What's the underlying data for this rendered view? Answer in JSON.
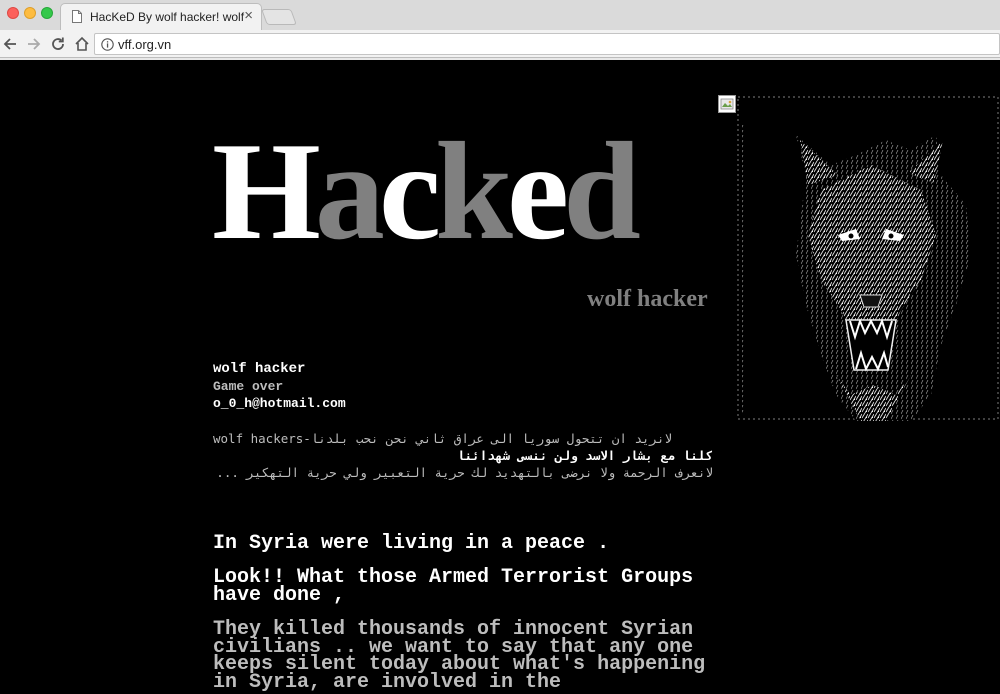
{
  "browser": {
    "tab_title": "HacKeD By wolf hacker! wolf",
    "tab_close": "×",
    "url": "vff.org.vn"
  },
  "page": {
    "headline": {
      "part1": "H",
      "part2": "a",
      "part3": "c",
      "part4": "k",
      "part5": "e",
      "part6": "d"
    },
    "signature": "wolf hacker",
    "info": {
      "name": "wolf hacker",
      "status": "Game over",
      "email": "o_0_h@hotmail.com"
    },
    "arabic": {
      "line1": "wolf hackers-لانريد ان تتحول سوريا الى عراق ثاني نحن نحب بلدنا",
      "line2": "كلنا مع بشار الاسد ولن ننسى شهدائنا",
      "line3": "لانعرف الرحمة ولا نرضى بالتهديد لك حرية التعبير ولي حرية التهكير ..."
    },
    "messages": {
      "m1": "In Syria were living in a peace .",
      "m2": "Look!! What those Armed Terrorist Groups have done ,",
      "m3": "They killed thousands of innocent Syrian civilians .. we want to say that any one keeps silent today about what's happening in Syria, are involved in the"
    }
  },
  "colors": {
    "white": "#ffffff",
    "gray": "#808080",
    "light_gray": "#bdbdbd",
    "background": "#000000"
  }
}
